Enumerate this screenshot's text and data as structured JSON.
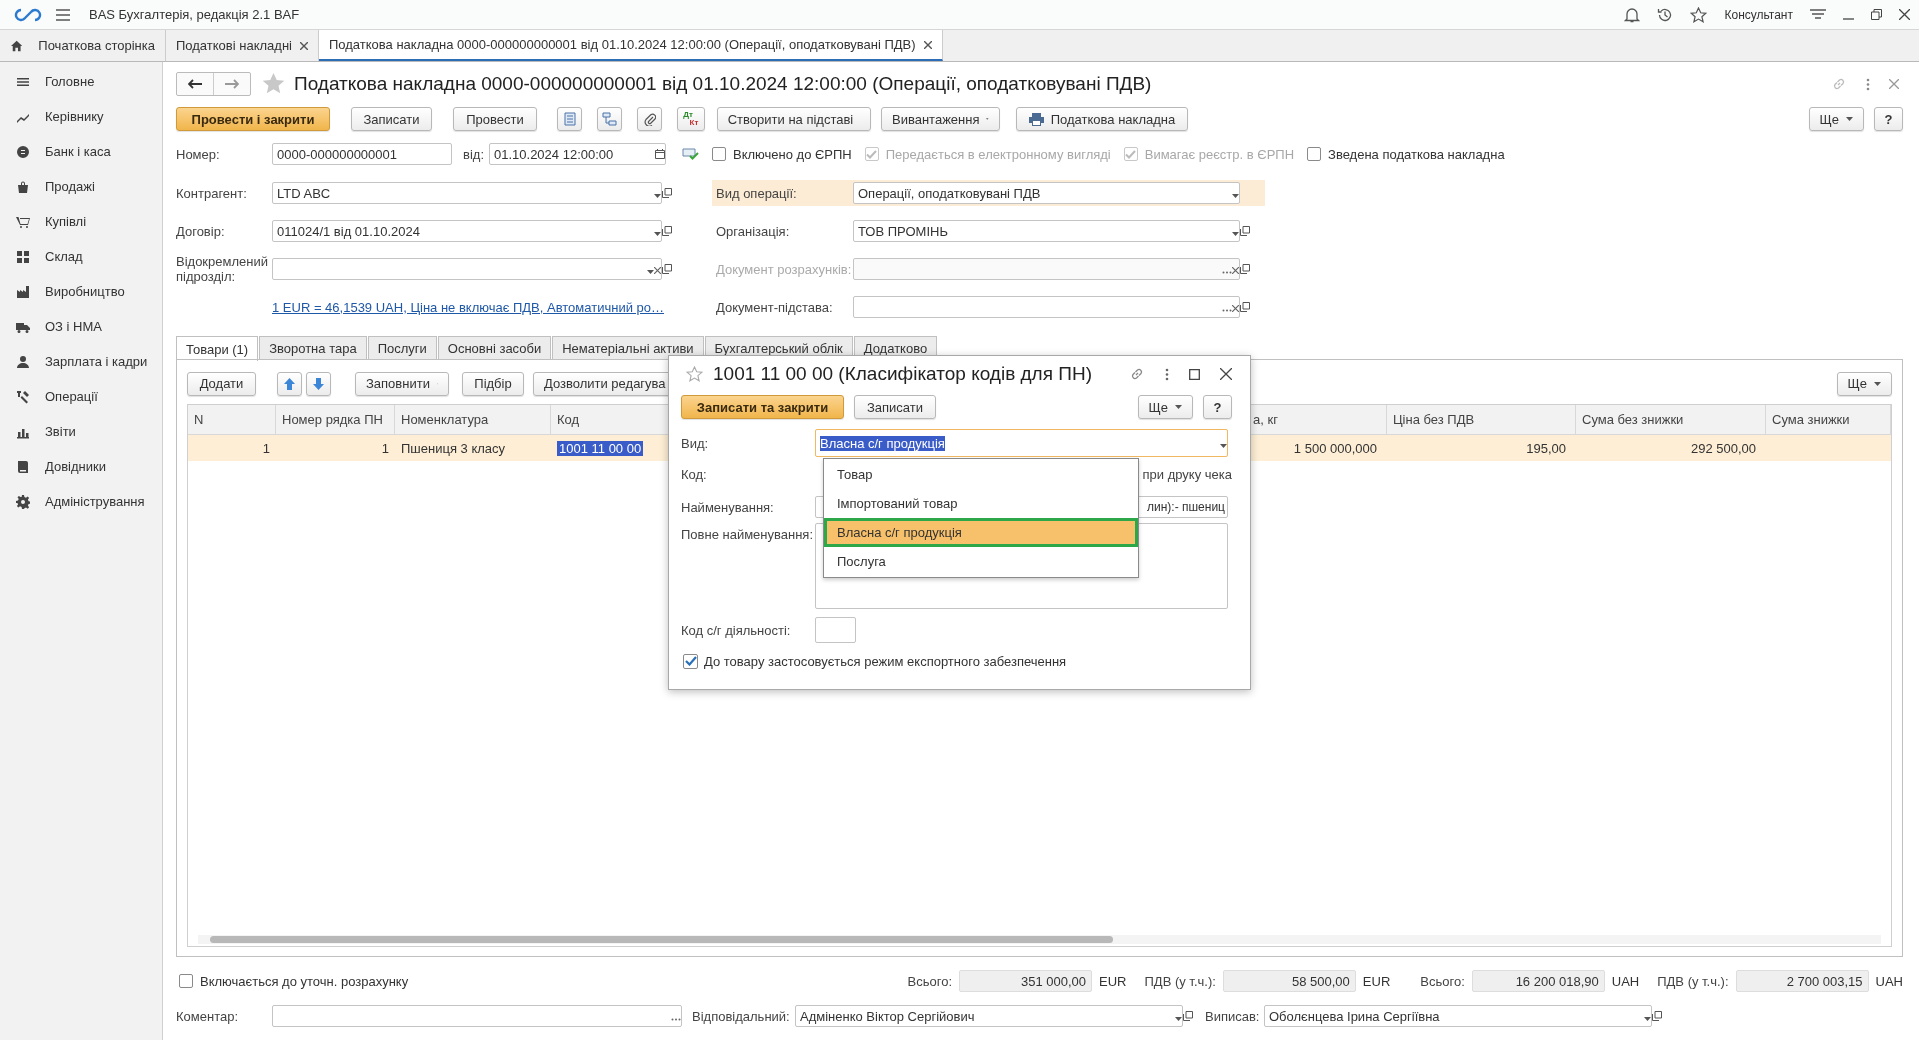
{
  "app": {
    "title": "BAS Бухгалтерія, редакція 2.1 BAF",
    "user": "Консультант"
  },
  "open_tabs": [
    {
      "label": "Початкова сторінка",
      "kind": "home",
      "selected": false
    },
    {
      "label": "Податкові накладні",
      "kind": "closable",
      "selected": false
    },
    {
      "label": "Податкова накладна 0000-000000000001 від 01.10.2024 12:00:00 (Операції, оподатковувані ПДВ)",
      "kind": "closable",
      "selected": true
    }
  ],
  "sidebar": {
    "items": [
      {
        "label": "Головне"
      },
      {
        "label": "Керівнику"
      },
      {
        "label": "Банк і каса"
      },
      {
        "label": "Продажі"
      },
      {
        "label": "Купівлі"
      },
      {
        "label": "Склад"
      },
      {
        "label": "Виробництво"
      },
      {
        "label": "ОЗ і НМА"
      },
      {
        "label": "Зарплата і кадри"
      },
      {
        "label": "Операції"
      },
      {
        "label": "Звіти"
      },
      {
        "label": "Довідники"
      },
      {
        "label": "Адміністрування"
      }
    ]
  },
  "document": {
    "title": "Податкова накладна 0000-000000000001 від 01.10.2024 12:00:00 (Операції, оподатковувані ПДВ)",
    "toolbar": {
      "primary": "Провести і закрити",
      "buttons": [
        "Записати",
        "Провести"
      ],
      "posting": {
        "debit": "Дт",
        "credit": "Кт"
      },
      "menus": [
        "Створити на підставі",
        "Вивантаження"
      ],
      "print": "Податкова накладна",
      "more": "Ще",
      "help": "?"
    },
    "number": {
      "label": "Номер:",
      "value": "0000-000000000001"
    },
    "date": {
      "label": "від:",
      "value": "01.10.2024 12:00:00",
      "calendar": true
    },
    "flags": [
      {
        "label": "Включено до ЄРПН",
        "checked": false,
        "disabled": false
      },
      {
        "label": "Передається в електронному вигляді",
        "checked": true,
        "disabled": true
      },
      {
        "label": "Вимагає реєстр. в ЄРПН",
        "checked": true,
        "disabled": true
      },
      {
        "label": "Зведена податкова накладна",
        "checked": false,
        "disabled": false
      }
    ],
    "left_fields": [
      {
        "label": "Контрагент:",
        "value": "LTD ABC",
        "dropdown": true,
        "open": true
      },
      {
        "label": "Договір:",
        "value": "011024/1 від 01.10.2024",
        "dropdown": true,
        "open": true
      },
      {
        "label": "Відокремлений підрозділ:",
        "dropdown": true,
        "clear": true,
        "open": true
      }
    ],
    "rate_link": "1 EUR = 46,1539 UAH, Ціна не включає ПДВ, Автоматичний ро…",
    "right_fields": [
      {
        "label": "Вид операції:",
        "value": "Операції, оподатковувані ПДВ",
        "highlighted": true,
        "disabled": false,
        "dropdown": true
      },
      {
        "label": "Організація:",
        "value": "ТОВ ПРОМІНЬ",
        "highlighted": false,
        "disabled": false,
        "dropdown": true,
        "open": true
      },
      {
        "label": "Документ розрахунків:",
        "highlighted": false,
        "disabled": true,
        "choose": true,
        "clear": true,
        "open": true
      },
      {
        "label": "Документ-підстава:",
        "highlighted": false,
        "disabled": false,
        "choose": true,
        "clear": true,
        "open": true
      }
    ],
    "tabs": [
      {
        "label": "Товари (1)",
        "selected": true
      },
      {
        "label": "Зворотна тара",
        "selected": false
      },
      {
        "label": "Послуги",
        "selected": false
      },
      {
        "label": "Основні засоби",
        "selected": false
      },
      {
        "label": "Нематеріальні активи",
        "selected": false
      },
      {
        "label": "Бухгалтерський облік",
        "selected": false
      },
      {
        "label": "Додатково",
        "selected": false
      }
    ],
    "table_toolbar": {
      "add": "Додати",
      "fill": "Заповнити",
      "pick": "Підбір",
      "allow_edit": "Дозволити редагува",
      "more": "Ще"
    },
    "table": {
      "columns": [
        "N",
        "Номер рядка ПН",
        "Номенклатура",
        "Код",
        "а, кг",
        "Ціна без ПДВ",
        "Сума без знижки",
        "Сума знижки"
      ],
      "rows": [
        {
          "selected": true,
          "cells": [
            "1",
            "1",
            "Пшениця 3 класу",
            "1001 11 00 00",
            "1 500 000,000",
            "195,00",
            "292 500,00"
          ]
        }
      ]
    },
    "adjustment": {
      "label": "Включається до уточн. розрахунку",
      "checked": false
    },
    "totals": [
      {
        "label": "Всього:",
        "value": "351 000,00",
        "currency": "EUR"
      },
      {
        "label": "ПДВ (у т.ч.):",
        "value": "58 500,00",
        "currency": "EUR"
      },
      {
        "label": "Всього:",
        "value": "16 200 018,90",
        "currency": "UAH"
      },
      {
        "label": "ПДВ (у т.ч.):",
        "value": "2 700 003,15",
        "currency": "UAH"
      }
    ],
    "comment": {
      "label": "Коментар:",
      "choose": true
    },
    "responsible": {
      "label": "Відповідальний:",
      "value": "Адміненко Віктор Сергійович",
      "dropdown": true,
      "open": true
    },
    "issued_by": {
      "label": "Виписав:",
      "value": "Оболєнцева Ірина Сергіївна",
      "dropdown": true,
      "open": true
    }
  },
  "dialog": {
    "title": "1001 11 00 00 (Класифікатор кодів для ПН)",
    "primary": "Записати та закрити",
    "save": "Записати",
    "more": "Ще",
    "help": "?",
    "kind_field": {
      "label": "Вид:",
      "value": "Власна с/г продукція",
      "text_selected": true,
      "dropdown": true
    },
    "code_label": "Код:",
    "code_trailing": "при друку чека",
    "name_field": {
      "label": "Найменування:",
      "value": "лин):- пшениц"
    },
    "full_name_label": "Повне найменування:",
    "activity_code_label": "Код с/г діяльності:",
    "export": {
      "label": "До товару застосовується режим експортного забезпечення",
      "checked": true
    },
    "options": [
      {
        "label": "Товар",
        "selected": false
      },
      {
        "label": "Імпортований товар",
        "selected": false
      },
      {
        "label": "Власна с/г продукція",
        "selected": true
      },
      {
        "label": "Послуга",
        "selected": false
      }
    ]
  }
}
